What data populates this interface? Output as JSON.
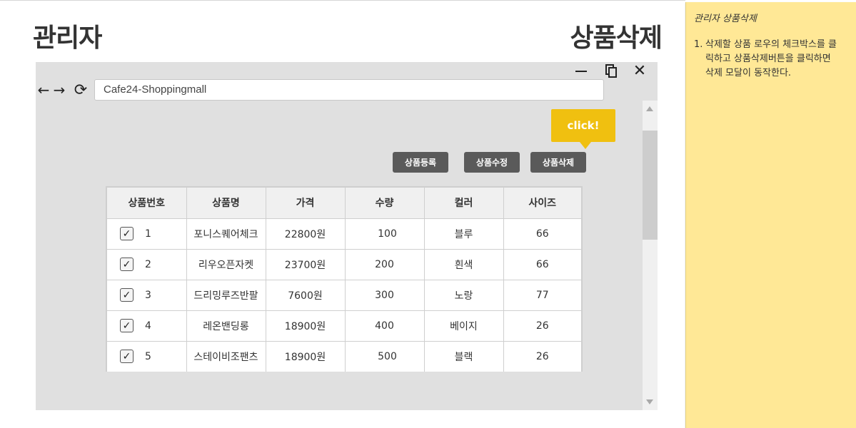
{
  "page": {
    "left_title": "관리자",
    "right_title": "상품삭제"
  },
  "browser": {
    "url": "Cafe24-Shoppingmall",
    "icons": {
      "minimize": "minimize-icon",
      "restore": "restore-icon",
      "close": "close-icon",
      "back": "arrow-left-icon",
      "forward": "arrow-right-icon",
      "reload": "reload-icon"
    }
  },
  "callout": {
    "text": "click!",
    "color": "#f0c010"
  },
  "actions": {
    "register": "상품등록",
    "edit": "상품수정",
    "delete": "상품삭제"
  },
  "table": {
    "headers": [
      "상품번호",
      "상품명",
      "가격",
      "수량",
      "컬러",
      "사이즈"
    ],
    "rows": [
      {
        "checked": true,
        "id": "1",
        "name": "포니스퀘어체크",
        "price": "22800원",
        "qty": "100",
        "color": "블루",
        "size": "66"
      },
      {
        "checked": true,
        "id": "2",
        "name": "리우오픈자켓",
        "price": "23700원",
        "qty": "200",
        "color": "흰색",
        "size": "66"
      },
      {
        "checked": true,
        "id": "3",
        "name": "드리밍루즈반팔",
        "price": "7600원",
        "qty": "300",
        "color": "노랑",
        "size": "77"
      },
      {
        "checked": true,
        "id": "4",
        "name": "레온밴딩롱",
        "price": "18900원",
        "qty": "400",
        "color": "베이지",
        "size": "26"
      },
      {
        "checked": true,
        "id": "5",
        "name": "스테이비조팬츠",
        "price": "18900원",
        "qty": "500",
        "color": "블랙",
        "size": "26"
      }
    ]
  },
  "note": {
    "title": "관리자 상품삭제",
    "items": [
      {
        "num": "1.",
        "text": "삭제할 상품 로우의 체크박스를 클릭하고 상품삭제버튼을 클릭하면 삭제 모달이 동작한다."
      }
    ],
    "color": "#ffe896"
  }
}
